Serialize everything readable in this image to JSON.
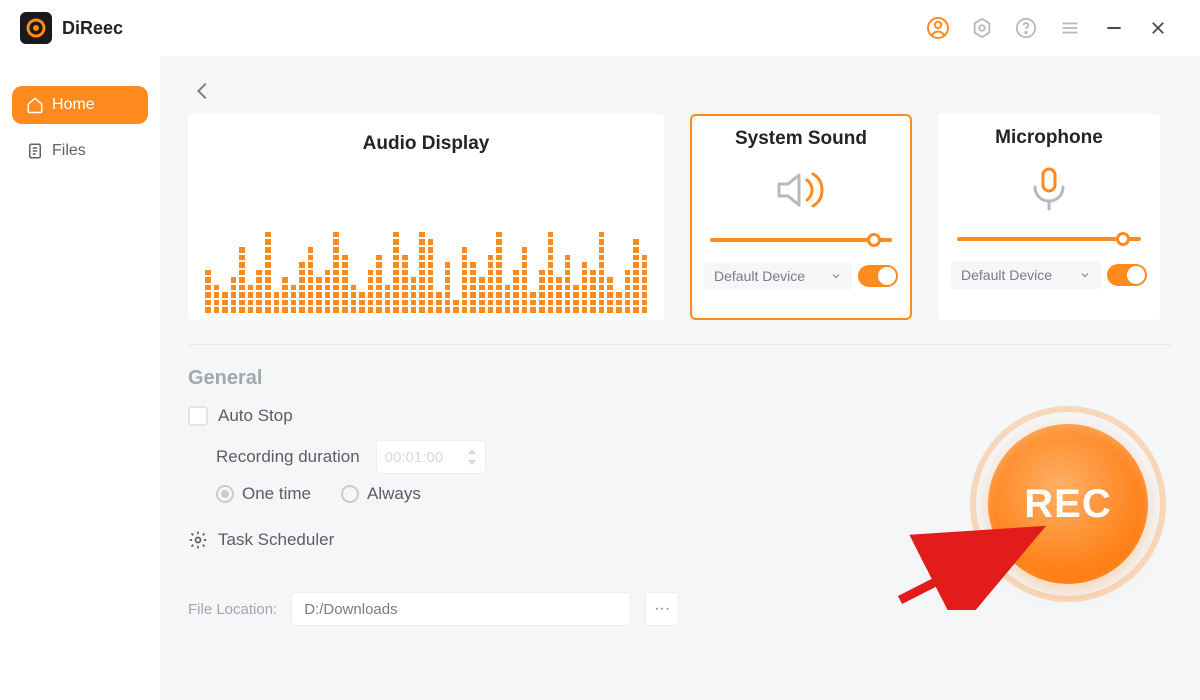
{
  "app": {
    "name": "DiReec"
  },
  "sidebar": {
    "items": [
      {
        "label": "Home"
      },
      {
        "label": "Files"
      }
    ]
  },
  "cards": {
    "audio_display": {
      "title": "Audio Display"
    },
    "system_sound": {
      "title": "System Sound",
      "device": "Default Device",
      "volume_pct": 90,
      "enabled": true
    },
    "microphone": {
      "title": "Microphone",
      "device": "Default Device",
      "volume_pct": 90,
      "enabled": true
    }
  },
  "general": {
    "heading": "General",
    "auto_stop_label": "Auto Stop",
    "auto_stop_checked": false,
    "duration_label": "Recording duration",
    "duration_value": "00:01:00",
    "one_time_label": "One time",
    "always_label": "Always",
    "mode": "one_time",
    "task_scheduler_label": "Task Scheduler"
  },
  "file": {
    "label": "File Location:",
    "path": "D:/Downloads"
  },
  "rec": {
    "label": "REC"
  },
  "eq_heights": [
    6,
    4,
    3,
    5,
    9,
    4,
    6,
    11,
    3,
    5,
    4,
    7,
    9,
    5,
    6,
    11,
    8,
    4,
    3,
    6,
    8,
    4,
    11,
    8,
    5,
    11,
    10,
    3,
    7,
    2,
    9,
    7,
    5,
    8,
    11,
    4,
    6,
    9,
    3,
    6,
    11,
    5,
    8,
    4,
    7,
    6,
    11,
    5,
    3,
    6,
    10,
    8
  ]
}
